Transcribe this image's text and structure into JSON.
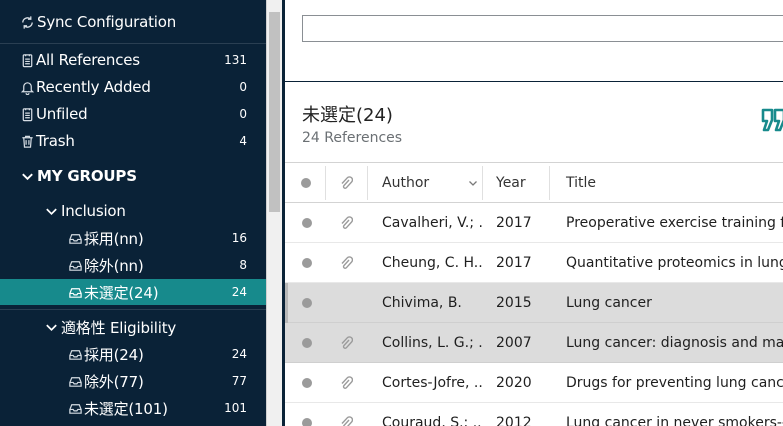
{
  "sidebar": {
    "sync": {
      "label": "Sync Configuration",
      "icon": "sync-icon"
    },
    "library": [
      {
        "label": "All References",
        "count": "131",
        "icon": "document-icon"
      },
      {
        "label": "Recently Added",
        "count": "0",
        "icon": "bell-icon"
      },
      {
        "label": "Unfiled",
        "count": "0",
        "icon": "document-icon"
      },
      {
        "label": "Trash",
        "count": "4",
        "icon": "trash-icon"
      }
    ],
    "my_groups": {
      "label": "MY GROUPS",
      "icon": "chevron-down-icon"
    },
    "group_sets": [
      {
        "label": "Inclusion",
        "groups": [
          {
            "label": "採用(nn)",
            "count": "16"
          },
          {
            "label": "除外(nn)",
            "count": "8"
          },
          {
            "label": "未選定(24)",
            "count": "24",
            "active": true
          }
        ]
      },
      {
        "label": "適格性 Eligibility",
        "groups": [
          {
            "label": "採用(24)",
            "count": "24"
          },
          {
            "label": "除外(77)",
            "count": "77"
          },
          {
            "label": "未選定(101)",
            "count": "101"
          }
        ]
      }
    ]
  },
  "main": {
    "search": {
      "value": "",
      "placeholder": ""
    },
    "group_title": "未選定(24)",
    "group_subtitle": "24 References",
    "columns": {
      "author": "Author",
      "year": "Year",
      "title": "Title"
    },
    "rows": [
      {
        "author": "Cavalheri, V.; ...",
        "year": "2017",
        "title": "Preoperative exercise training for",
        "attachment": true,
        "selected": false
      },
      {
        "author": "Cheung, C. H....",
        "year": "2017",
        "title": "Quantitative proteomics in lung c",
        "attachment": true,
        "selected": false
      },
      {
        "author": "Chivima, B.",
        "year": "2015",
        "title": "Lung cancer",
        "attachment": false,
        "selected": true
      },
      {
        "author": "Collins, L. G.; ...",
        "year": "2007",
        "title": "Lung cancer: diagnosis and mana",
        "attachment": true,
        "selected": true
      },
      {
        "author": "Cortes-Jofre, ...",
        "year": "2020",
        "title": "Drugs for preventing lung cancer",
        "attachment": true,
        "selected": false
      },
      {
        "author": "Couraud, S.; ...",
        "year": "2012",
        "title": "Lung cancer in never smokers--a",
        "attachment": true,
        "selected": false
      }
    ]
  },
  "colors": {
    "sidebar_bg": "#0a2237",
    "active_bg": "#178a8c",
    "accent": "#178a8c",
    "selected_row": "#dcdcdc"
  }
}
